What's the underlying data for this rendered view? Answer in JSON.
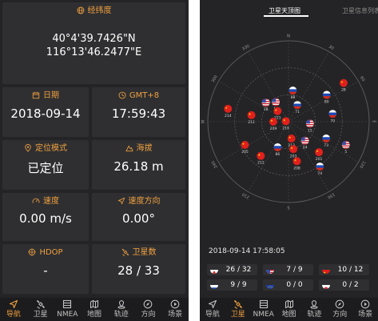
{
  "left": {
    "latlon": {
      "title": "经纬度",
      "lat": "40°4'39.7426\"N",
      "lon": "116°13'46.2477\"E"
    },
    "date": {
      "title": "日期",
      "value": "2018-09-14"
    },
    "time": {
      "title": "GMT+8",
      "value": "17:59:43"
    },
    "fix_mode": {
      "title": "定位模式",
      "value": "已定位"
    },
    "altitude": {
      "title": "海拔",
      "value": "26.18 m"
    },
    "speed": {
      "title": "速度",
      "value": "0.00 m/s"
    },
    "heading": {
      "title": "速度方向",
      "value": "0.00°"
    },
    "hdop": {
      "title": "HDOP",
      "value": "-"
    },
    "satellites": {
      "title": "卫星数",
      "value": "28 / 33"
    }
  },
  "nav": [
    {
      "label": "导航",
      "icon": "navigation-arrow-icon"
    },
    {
      "label": "卫星",
      "icon": "satellite-icon"
    },
    {
      "label": "NMEA",
      "icon": "nmea-grid-icon"
    },
    {
      "label": "地图",
      "icon": "map-icon"
    },
    {
      "label": "轨迹",
      "icon": "track-pin-icon"
    },
    {
      "label": "方向",
      "icon": "compass-icon"
    },
    {
      "label": "场景",
      "icon": "scene-play-icon"
    }
  ],
  "left_active_nav": 0,
  "right_active_nav": 1,
  "right": {
    "tabs": {
      "skyview": "卫星天顶图",
      "satlist": "卫星信息列表"
    },
    "compass_labels": [
      "N",
      "30",
      "60",
      "E",
      "120",
      "150",
      "S",
      "210",
      "240",
      "W",
      "300",
      "330"
    ],
    "satellites": [
      {
        "id": "88",
        "flag": "russia",
        "azimuth": 8,
        "elevation": 55
      },
      {
        "id": "28",
        "flag": "china",
        "azimuth": 55,
        "elevation": 15
      },
      {
        "id": "80",
        "flag": "russia",
        "azimuth": 55,
        "elevation": 38
      },
      {
        "id": "71",
        "flag": "russia",
        "azimuth": 28,
        "elevation": 69
      },
      {
        "id": "70",
        "flag": "russia",
        "azimuth": 80,
        "elevation": 40
      },
      {
        "id": "18",
        "flag": "usa",
        "azimuth": 310,
        "elevation": 57
      },
      {
        "id": "10",
        "flag": "usa",
        "azimuth": 327,
        "elevation": 64
      },
      {
        "id": "221",
        "flag": "china",
        "azimuth": 314,
        "elevation": 73
      },
      {
        "id": "214",
        "flag": "china",
        "azimuth": 282,
        "elevation": 21
      },
      {
        "id": "211",
        "flag": "china",
        "azimuth": 280,
        "elevation": 48
      },
      {
        "id": "15",
        "flag": "usa",
        "azimuth": 95,
        "elevation": 66
      },
      {
        "id": "216",
        "flag": "china",
        "azimuth": 280,
        "elevation": 87
      },
      {
        "id": "209",
        "flag": "china",
        "azimuth": 270,
        "elevation": 73
      },
      {
        "id": "73",
        "flag": "russia",
        "azimuth": 114,
        "elevation": 44
      },
      {
        "id": "5",
        "flag": "usa",
        "azimuth": 112,
        "elevation": 21
      },
      {
        "id": "205",
        "flag": "china",
        "azimuth": 242,
        "elevation": 35
      },
      {
        "id": "86",
        "flag": "russia",
        "azimuth": 203,
        "elevation": 59
      },
      {
        "id": "213",
        "flag": "china",
        "azimuth": 170,
        "elevation": 71
      },
      {
        "id": "24",
        "flag": "usa",
        "azimuth": 139,
        "elevation": 62
      },
      {
        "id": "201",
        "flag": "china",
        "azimuth": 135,
        "elevation": 42
      },
      {
        "id": "203",
        "flag": "china",
        "azimuth": 170,
        "elevation": 59
      },
      {
        "id": "212",
        "flag": "china",
        "azimuth": 219,
        "elevation": 41
      },
      {
        "id": "208",
        "flag": "china",
        "azimuth": 168,
        "elevation": 45
      },
      {
        "id": "74",
        "flag": "russia",
        "azimuth": 145,
        "elevation": 29
      }
    ],
    "datetime": "2018-09-14  17:58:05",
    "counts": [
      {
        "flag": "all",
        "value": "26 / 32"
      },
      {
        "flag": "usa",
        "value": "7 / 9"
      },
      {
        "flag": "china",
        "value": "10 / 12"
      },
      {
        "flag": "russia",
        "value": "9 / 9"
      },
      {
        "flag": "eu",
        "value": "0 / 0"
      },
      {
        "flag": "japan",
        "value": "0 / 2"
      }
    ]
  },
  "colors": {
    "accent": "#f0a040",
    "background": "#242426",
    "card": "#2f2f31",
    "china_red": "#e0201c",
    "navbar": "#1c1c1e"
  }
}
